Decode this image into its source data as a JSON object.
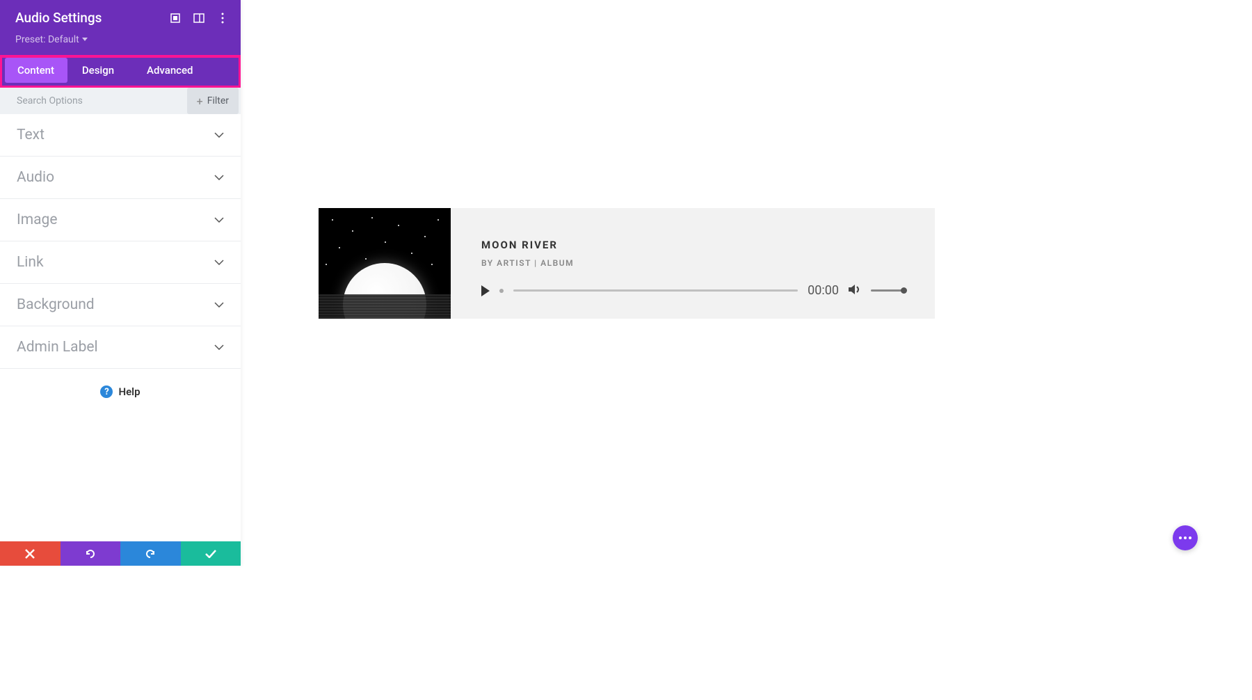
{
  "sidebar": {
    "title": "Audio Settings",
    "preset_label": "Preset: Default",
    "tabs": [
      {
        "label": "Content",
        "active": true
      },
      {
        "label": "Design",
        "active": false
      },
      {
        "label": "Advanced",
        "active": false
      }
    ],
    "search_placeholder": "Search Options",
    "filter_label": "Filter",
    "sections": [
      {
        "label": "Text"
      },
      {
        "label": "Audio"
      },
      {
        "label": "Image"
      },
      {
        "label": "Link"
      },
      {
        "label": "Background"
      },
      {
        "label": "Admin Label"
      }
    ],
    "help_label": "Help"
  },
  "player": {
    "track_title": "MOON RIVER",
    "track_meta": "BY ARTIST | ALBUM",
    "time": "00:00"
  }
}
